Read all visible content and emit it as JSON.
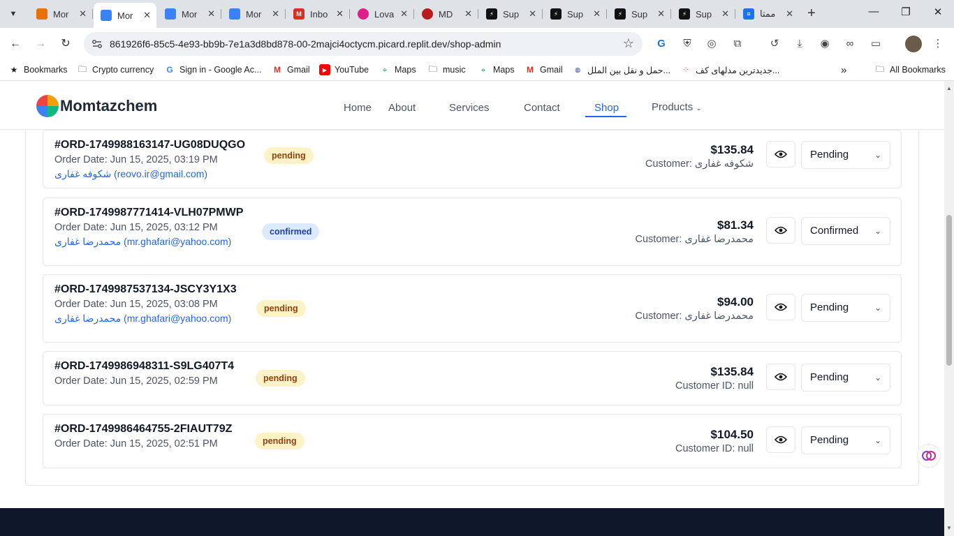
{
  "tabs": [
    {
      "title": "Mor",
      "favicon": "orange-dots-favicon",
      "color": "#e8710a"
    },
    {
      "title": "Mor",
      "favicon": "momtazchem-favicon",
      "color": "#3b82f6",
      "active": true
    },
    {
      "title": "Mor",
      "favicon": "momtazchem-favicon",
      "color": "#3b82f6"
    },
    {
      "title": "Mor",
      "favicon": "momtazchem-favicon",
      "color": "#3b82f6"
    },
    {
      "title": "Inbo",
      "favicon": "gmail-favicon",
      "color": "#d93025"
    },
    {
      "title": "Lova",
      "favicon": "lovable-favicon",
      "color": "#e11d8a"
    },
    {
      "title": "MD",
      "favicon": "md-favicon",
      "color": "#b91c1c"
    },
    {
      "title": "Sup",
      "favicon": "supabase-favicon",
      "color": "#111111"
    },
    {
      "title": "Sup",
      "favicon": "supabase-favicon",
      "color": "#111111"
    },
    {
      "title": "Sup",
      "favicon": "supabase-favicon",
      "color": "#111111"
    },
    {
      "title": "Sup",
      "favicon": "supabase-favicon",
      "color": "#111111"
    },
    {
      "title": "ممتا",
      "favicon": "docs-favicon",
      "color": "#1a73e8"
    }
  ],
  "browser": {
    "url": "861926f6-85c5-4e93-bb9b-7e1a3d8bd878-00-2majci4octycm.picard.replit.dev/shop-admin"
  },
  "bookmarks": [
    {
      "label": "Bookmarks",
      "icon": "star-icon"
    },
    {
      "label": "Crypto currency",
      "icon": "folder-icon"
    },
    {
      "label": "Sign in - Google Ac...",
      "icon": "google-icon"
    },
    {
      "label": "Gmail",
      "icon": "gmail-icon"
    },
    {
      "label": "YouTube",
      "icon": "youtube-icon"
    },
    {
      "label": "Maps",
      "icon": "maps-icon"
    },
    {
      "label": "music",
      "icon": "folder-icon"
    },
    {
      "label": "Maps",
      "icon": "maps-icon"
    },
    {
      "label": "Gmail",
      "icon": "gmail-icon"
    },
    {
      "label": "حمل و نقل بین الملل...",
      "icon": "globe-icon"
    },
    {
      "label": "جدیدترین مدلهای کف...",
      "icon": "dots-icon"
    },
    {
      "label": "All Bookmarks",
      "icon": "folder-icon"
    }
  ],
  "site": {
    "brand": "Momtazchem",
    "nav": [
      "Home",
      "About",
      "Services",
      "Contact",
      "Shop",
      "Products"
    ],
    "active_nav": "Shop",
    "accent": "#2563eb"
  },
  "orders": [
    {
      "id": "#ORD-1749988163147-UG08DUQGO",
      "date": "Order Date: Jun 15, 2025, 03:19 PM",
      "customer_line": "شکوفه غفاری (reovo.ir@gmail.com)",
      "status_badge": "pending",
      "amount": "$135.84",
      "customer": "Customer: شکوفه غفاری",
      "status_select": "Pending"
    },
    {
      "id": "#ORD-1749987771414-VLH07PMWP",
      "date": "Order Date: Jun 15, 2025, 03:12 PM",
      "customer_line": "محمدرضا غفاری (mr.ghafari@yahoo.com)",
      "status_badge": "confirmed",
      "amount": "$81.34",
      "customer": "Customer: محمدرضا غفاری",
      "status_select": "Confirmed"
    },
    {
      "id": "#ORD-1749987537134-JSCY3Y1X3",
      "date": "Order Date: Jun 15, 2025, 03:08 PM",
      "customer_line": "محمدرضا غفاری (mr.ghafari@yahoo.com)",
      "status_badge": "pending",
      "amount": "$94.00",
      "customer": "Customer: محمدرضا غفاری",
      "status_select": "Pending"
    },
    {
      "id": "#ORD-1749986948311-S9LG407T4",
      "date": "Order Date: Jun 15, 2025, 02:59 PM",
      "status_badge": "pending",
      "amount": "$135.84",
      "customer": "Customer ID: null",
      "status_select": "Pending"
    },
    {
      "id": "#ORD-1749986464755-2FIAUT79Z",
      "date": "Order Date: Jun 15, 2025, 02:51 PM",
      "status_badge": "pending",
      "amount": "$104.50",
      "customer": "Customer ID: null",
      "status_select": "Pending"
    }
  ],
  "colors": {
    "pending_bg": "#fef3c7",
    "pending_fg": "#92400e",
    "confirmed_bg": "#dbeafe",
    "confirmed_fg": "#1e40af",
    "footer": "#0f172a"
  }
}
